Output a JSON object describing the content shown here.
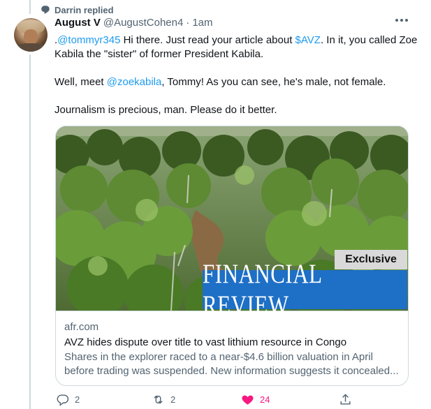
{
  "context": {
    "replied_label": "Darrin replied"
  },
  "tweet": {
    "display_name": "August V",
    "handle": "@AugustCohen4",
    "separator": "·",
    "time": "1am",
    "text": {
      "line1_prefix": ".",
      "mention1": "@tommyr345",
      "line1_mid": " Hi there. Just read your article about ",
      "cashtag": "$AVZ",
      "line1_suffix": ". In it, you called Zoe Kabila the \"sister\" of former President Kabila.",
      "line2_prefix": "Well, meet ",
      "mention2": "@zoekabila",
      "line2_suffix": ", Tommy! As you can see, he's male, not female.",
      "line3": "Journalism is precious, man. Please do it better."
    }
  },
  "card": {
    "image_badge": "Exclusive",
    "image_banner": "FINANCIAL REVIEW",
    "domain": "afr.com",
    "title": "AVZ hides dispute over title to vast lithium resource in Congo",
    "description": "Shares in the explorer raced to a near-$4.6 billion valuation in April before trading was suspended. New information suggests it concealed..."
  },
  "actions": {
    "reply_count": "2",
    "retweet_count": "2",
    "like_count": "24"
  },
  "icons": {
    "replied": "retweet-style-replied-icon",
    "more": "more-horizontal-icon",
    "reply": "reply-icon",
    "retweet": "retweet-icon",
    "like": "heart-filled-icon",
    "share": "share-icon"
  },
  "colors": {
    "link": "#1d9bf0",
    "like": "#f91880",
    "secondary_text": "#536471",
    "banner_blue": "#1e6fc6"
  }
}
